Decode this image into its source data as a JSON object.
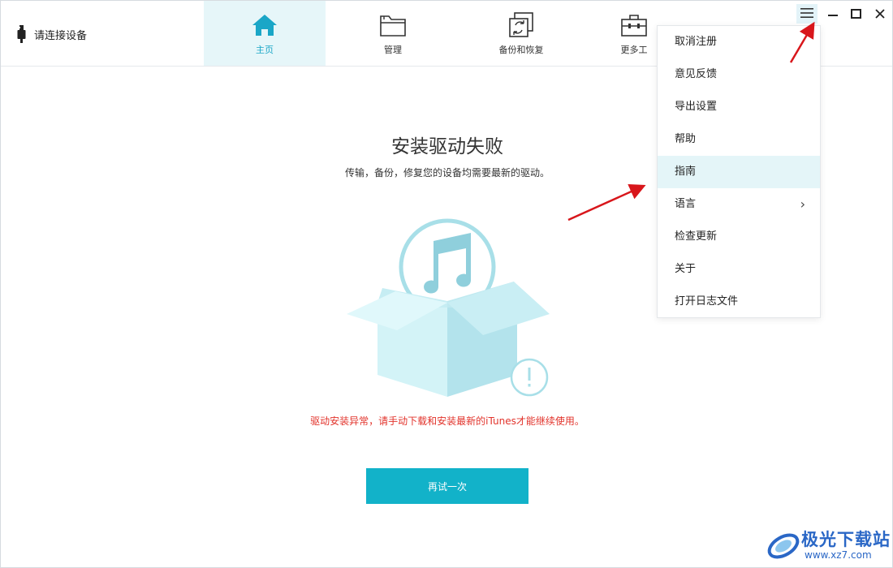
{
  "header": {
    "device_status": "请连接设备",
    "tabs": [
      {
        "label": "主页",
        "icon": "home-icon",
        "active": true
      },
      {
        "label": "管理",
        "icon": "folder-icon",
        "active": false
      },
      {
        "label": "备份和恢复",
        "icon": "backup-restore-icon",
        "active": false
      },
      {
        "label": "更多工",
        "icon": "toolbox-icon",
        "active": false
      }
    ],
    "window_controls": [
      "menu-icon",
      "minimize-icon",
      "maximize-icon",
      "close-icon"
    ]
  },
  "main": {
    "title": "安装驱动失败",
    "subtitle": "传输，备份，修复您的设备均需要最新的驱动。",
    "illustration": "itunes-box-warning",
    "error": "驱动安装异常，请手动下载和安装最新的iTunes才能继续使用。",
    "retry_label": "再试一次"
  },
  "menu": {
    "items": [
      {
        "label": "取消注册"
      },
      {
        "label": "意见反馈"
      },
      {
        "label": "导出设置"
      },
      {
        "label": "帮助"
      },
      {
        "label": "指南",
        "hovered": true
      },
      {
        "label": "语言",
        "submenu": true,
        "chevron": "›"
      },
      {
        "label": "检查更新"
      },
      {
        "label": "关于"
      },
      {
        "label": "打开日志文件"
      }
    ]
  },
  "watermark": {
    "name": "极光下载站",
    "url": "www.xz7.com"
  },
  "colors": {
    "accent": "#12b2c9",
    "active_tab_bg": "#e6f6f9",
    "error": "#e2332b",
    "arrow": "#d8161b",
    "illustration": "#a8dfe8"
  }
}
